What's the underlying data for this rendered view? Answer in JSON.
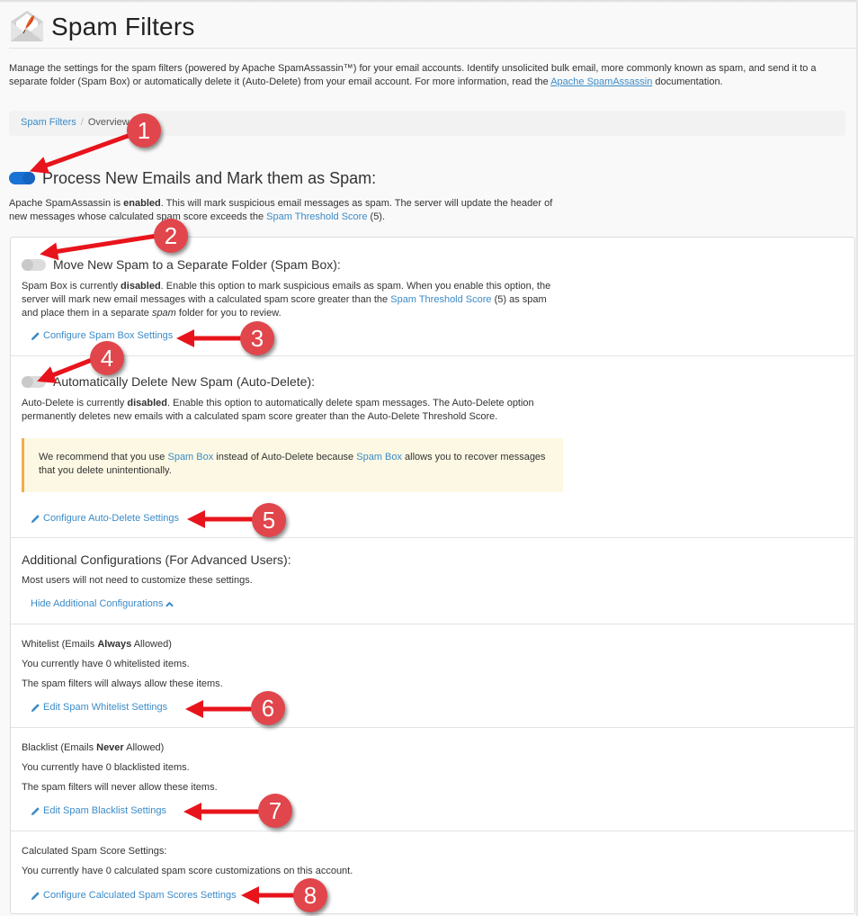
{
  "header": {
    "title": "Spam Filters",
    "icon": "envelope-feather-icon"
  },
  "intro": {
    "text_before_link": "Manage the settings for the spam filters (powered by Apache SpamAssassin™) for your email accounts. Identify unsolicited bulk email, more commonly known as spam, and send it to a separate folder (Spam Box) or automatically delete it (Auto-Delete) from your email account. For more information, read the ",
    "link": "Apache SpamAssassin",
    "text_after_link": " documentation."
  },
  "breadcrumb": {
    "items": [
      {
        "label": "Spam Filters",
        "link": true
      },
      {
        "label": "Overview",
        "link": false
      }
    ],
    "separator": "/"
  },
  "process_emails": {
    "label": "Process New Emails and Mark them as Spam:",
    "enabled": true,
    "desc_1": "Apache SpamAssassin is ",
    "desc_bold": "enabled",
    "desc_2": ". This will mark suspicious email messages as spam. The server will update the header of new messages whose calculated spam score exceeds the ",
    "desc_link": "Spam Threshold Score",
    "desc_3": " (5)."
  },
  "spam_box": {
    "label": "Move New Spam to a Separate Folder (Spam Box):",
    "enabled": false,
    "desc_1": "Spam Box is currently ",
    "desc_bold": "disabled",
    "desc_2": ". Enable this option to mark suspicious emails as spam. When you enable this option, the server will mark new email messages with a calculated spam score greater than the ",
    "desc_link": "Spam Threshold Score",
    "desc_3": " (5) as spam and place them in a separate ",
    "desc_italic": "spam",
    "desc_4": " folder for you to review.",
    "action": "Configure Spam Box Settings"
  },
  "auto_delete": {
    "label": "Automatically Delete New Spam (Auto-Delete):",
    "enabled": false,
    "desc_1": "Auto-Delete is currently ",
    "desc_bold": "disabled",
    "desc_2": ". Enable this option to automatically delete spam messages. The Auto-Delete option permanently deletes new emails with a calculated spam score greater than the Auto-Delete Threshold Score.",
    "warning_1": "We recommend that you use ",
    "warning_link_1": "Spam Box",
    "warning_2": " instead of Auto-Delete because ",
    "warning_link_2": "Spam Box",
    "warning_3": " allows you to recover messages that you delete unintentionally.",
    "action": "Configure Auto-Delete Settings"
  },
  "advanced": {
    "title": "Additional Configurations (For Advanced Users):",
    "desc": "Most users will not need to customize these settings.",
    "toggle_link": "Hide Additional Configurations"
  },
  "whitelist": {
    "title_1": "Whitelist (Emails ",
    "title_bold": "Always",
    "title_2": " Allowed)",
    "count_text": "You currently have 0 whitelisted items.",
    "count": 0,
    "desc": "The spam filters will always allow these items.",
    "action": "Edit Spam Whitelist Settings"
  },
  "blacklist": {
    "title_1": "Blacklist (Emails ",
    "title_bold": "Never",
    "title_2": " Allowed)",
    "count_text": "You currently have 0 blacklisted items.",
    "count": 0,
    "desc": "The spam filters will never allow these items.",
    "action": "Edit Spam Blacklist Settings"
  },
  "calculated": {
    "title": "Calculated Spam Score Settings:",
    "desc": "You currently have 0 calculated spam score customizations on this account.",
    "count": 0,
    "action": "Configure Calculated Spam Scores Settings"
  },
  "annotations": [
    "1",
    "2",
    "3",
    "4",
    "5",
    "6",
    "7",
    "8"
  ],
  "colors": {
    "link": "#3b8bc8",
    "toggle_on": "#1a73d4",
    "toggle_off": "#dcdcdc",
    "warning_bg": "#fcf8e3",
    "warning_border": "#f0ad4e",
    "annotation": "#e0464b",
    "arrow": "#e8141c"
  }
}
